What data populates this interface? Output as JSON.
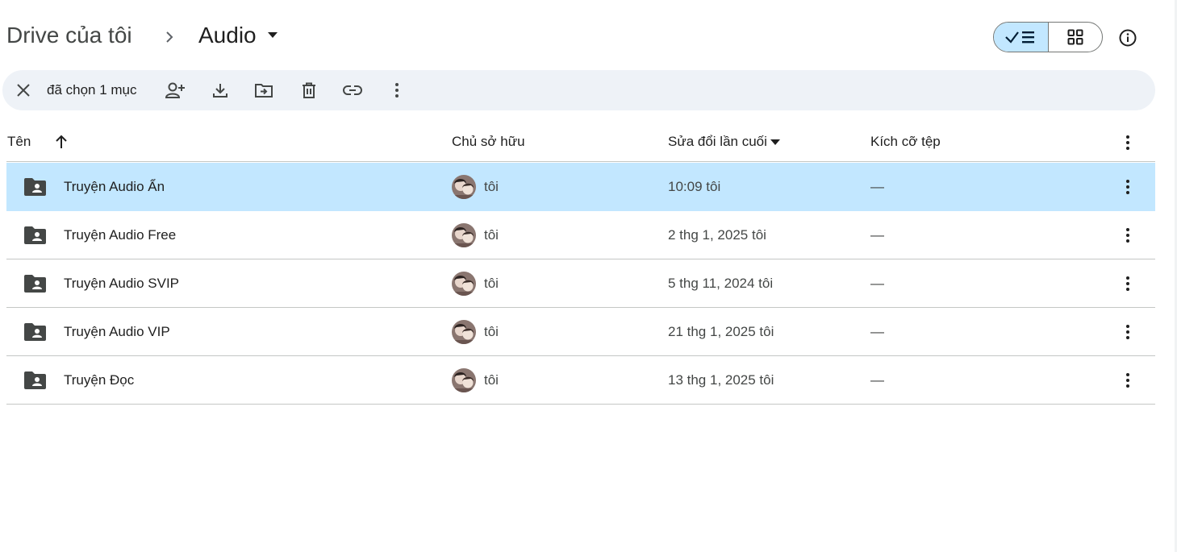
{
  "breadcrumb": {
    "root": "Drive của tôi",
    "current": "Audio"
  },
  "icons": {
    "breadcrumb_separator": "chevron-right-icon",
    "current_folder_menu": "caret-down-icon",
    "list_view": "check-list-icon",
    "grid_view": "grid-icon",
    "details": "info-icon"
  },
  "view_toggle": {
    "active": "list"
  },
  "action_bar": {
    "selected_label": "đã chọn 1 mục",
    "actions": [
      "close",
      "share",
      "download",
      "move",
      "delete",
      "copy-link",
      "more"
    ]
  },
  "table": {
    "columns": {
      "name": "Tên",
      "owner": "Chủ sở hữu",
      "modified": "Sửa đổi lần cuối",
      "size": "Kích cỡ tệp"
    },
    "rows": [
      {
        "name": "Truyện Audio Ẩn",
        "owner": "tôi",
        "modified": "10:09 tôi",
        "size": "—",
        "selected": true
      },
      {
        "name": "Truyện Audio Free",
        "owner": "tôi",
        "modified": "2 thg 1, 2025 tôi",
        "size": "—",
        "selected": false
      },
      {
        "name": "Truyện Audio SVIP",
        "owner": "tôi",
        "modified": "5 thg 11, 2024 tôi",
        "size": "—",
        "selected": false
      },
      {
        "name": "Truyện Audio VIP",
        "owner": "tôi",
        "modified": "21 thg 1, 2025 tôi",
        "size": "—",
        "selected": false
      },
      {
        "name": "Truyện Đọc",
        "owner": "tôi",
        "modified": "13 thg 1, 2025 tôi",
        "size": "—",
        "selected": false
      }
    ]
  },
  "colors": {
    "selected_row": "#c2e7ff",
    "action_bar_bg": "#eef2f7",
    "divider": "#c4c7c5",
    "icon": "#444746"
  }
}
